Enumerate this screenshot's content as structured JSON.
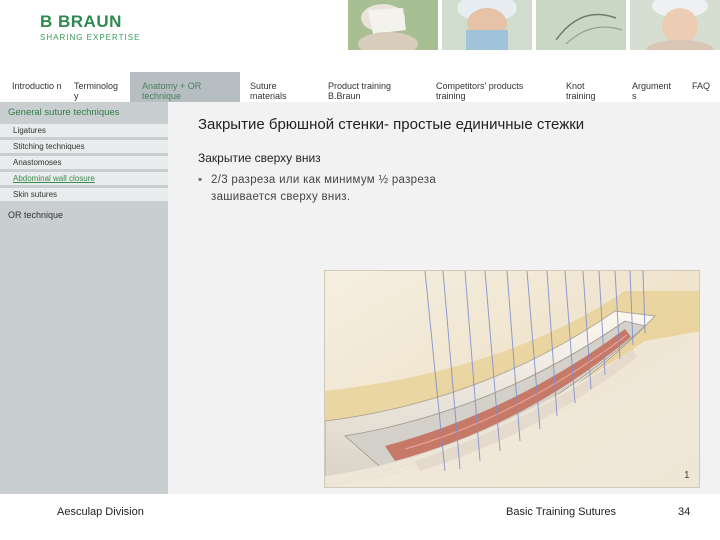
{
  "brand": {
    "name": "B BRAUN",
    "tagline": "SHARING EXPERTISE"
  },
  "nav": {
    "items": [
      {
        "label": "Introductio n",
        "active": false
      },
      {
        "label": "Terminolog y",
        "active": false
      },
      {
        "label": "Anatomy + OR technique",
        "active": true
      },
      {
        "label": "Suture materials",
        "active": false
      },
      {
        "label": "Product training B.Braun",
        "active": false
      },
      {
        "label": "Competitors' products training",
        "active": false
      },
      {
        "label": "Knot training",
        "active": false
      },
      {
        "label": "Argument s",
        "active": false
      },
      {
        "label": "FAQ",
        "active": false
      }
    ]
  },
  "sidebar": {
    "header": "General suture techniques",
    "items": [
      {
        "label": "Ligatures",
        "active": false
      },
      {
        "label": "Stitching techniques",
        "active": false
      },
      {
        "label": "Anastomoses",
        "active": false
      },
      {
        "label": "Abdominal wall closure",
        "active": true
      },
      {
        "label": "Skin sutures",
        "active": false
      }
    ],
    "or_technique": "OR technique"
  },
  "main": {
    "title": "Закрытие брюшной стенки- простые единичные стежки",
    "subheading": "Закрытие сверху вниз",
    "bullet_marker": "▪",
    "bullet_text": "2/3 разреза или как минимум ½ разреза зашивается сверху вниз.",
    "figure_number": "1"
  },
  "footer": {
    "division": "Aesculap Division",
    "course": "Basic Training Sutures",
    "page_number": "34"
  },
  "colors": {
    "brand_green": "#2f8a4f",
    "sidebar_bg": "#c9ced1",
    "main_bg": "#f2f2f2",
    "active_nav_bg": "#b7bec2"
  }
}
